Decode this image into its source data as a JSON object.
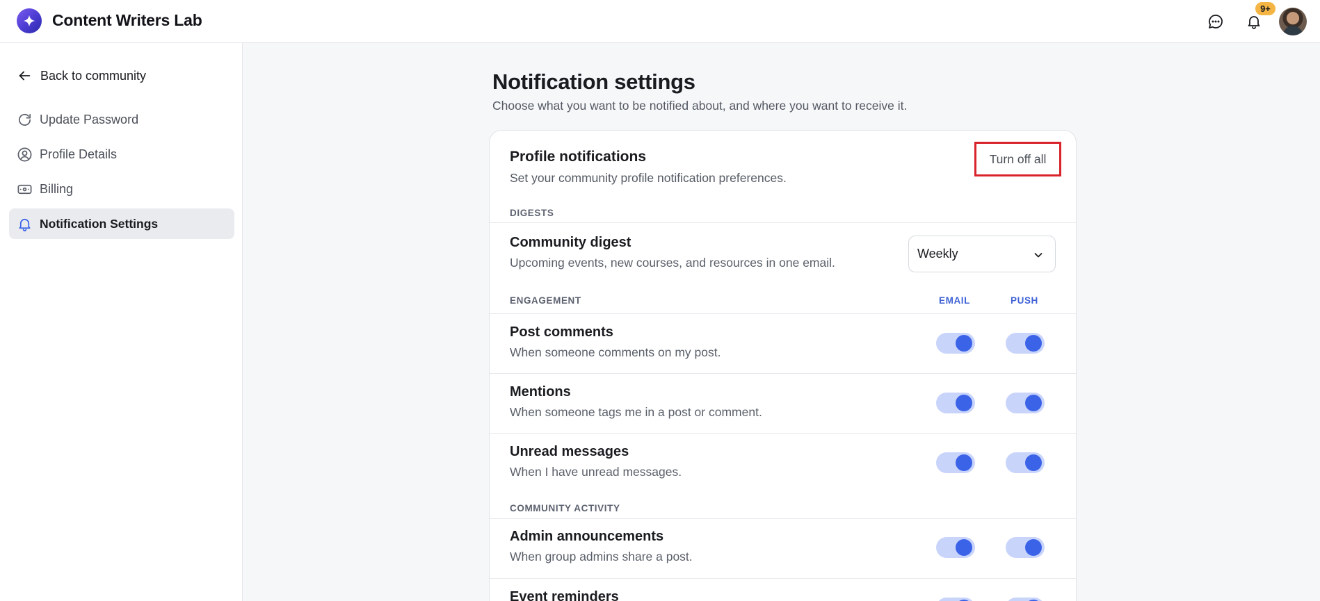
{
  "app": {
    "title": "Content Writers Lab"
  },
  "header": {
    "notification_badge": "9+",
    "icons": [
      "chat-icon",
      "bell-icon"
    ]
  },
  "sidebar": {
    "back_label": "Back to community",
    "items": [
      {
        "label": "Update Password",
        "icon": "refresh-icon"
      },
      {
        "label": "Profile Details",
        "icon": "user-circle-icon"
      },
      {
        "label": "Billing",
        "icon": "billing-icon"
      },
      {
        "label": "Notification Settings",
        "icon": "bell-icon",
        "active": true
      }
    ]
  },
  "main": {
    "title": "Notification settings",
    "subtitle": "Choose what you want to be notified about, and where you want to receive it."
  },
  "card": {
    "title": "Profile notifications",
    "subtitle": "Set your community profile notification preferences.",
    "turn_off_label": "Turn off all",
    "sections": {
      "digests": "DIGESTS",
      "engagement": "ENGAGEMENT",
      "community_activity": "COMMUNITY ACTIVITY"
    },
    "columns": {
      "email": "EMAIL",
      "push": "PUSH"
    },
    "digest": {
      "title": "Community digest",
      "desc": "Upcoming events, new courses, and resources in one email.",
      "frequency": "Weekly"
    },
    "rows": [
      {
        "title": "Post comments",
        "desc": "When someone comments on my post.",
        "email": true,
        "push": true
      },
      {
        "title": "Mentions",
        "desc": "When someone tags me in a post or comment.",
        "email": true,
        "push": true
      },
      {
        "title": "Unread messages",
        "desc": "When I have unread messages.",
        "email": true,
        "push": true
      },
      {
        "title": "Admin announcements",
        "desc": "When group admins share a post.",
        "email": true,
        "push": true
      },
      {
        "title": "Event reminders",
        "desc": "",
        "email": true,
        "push": true
      }
    ]
  },
  "colors": {
    "accent": "#3b63e8",
    "toggle_track": "#c9d4fb",
    "badge": "#f5b544",
    "highlight_box": "#d8232a"
  }
}
